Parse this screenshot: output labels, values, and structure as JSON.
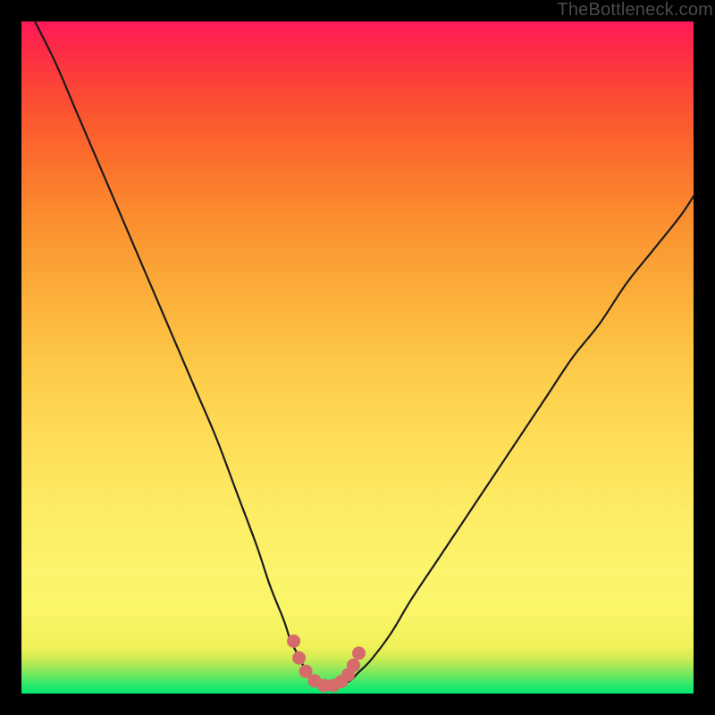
{
  "watermark": "TheBottleneck.com",
  "colors": {
    "bg": "#000000",
    "curve": "#1b1b1b",
    "marker_fill": "#d76b6b",
    "marker_stroke": "#c85a5a"
  },
  "chart_data": {
    "type": "line",
    "title": "",
    "xlabel": "",
    "ylabel": "",
    "xlim": [
      0,
      100
    ],
    "ylim": [
      0,
      100
    ],
    "grid": false,
    "annotations": [],
    "series": [
      {
        "name": "bottleneck-curve",
        "x": [
          2,
          5,
          8,
          11,
          14,
          17,
          20,
          23,
          26,
          29,
          32,
          35,
          37,
          39,
          40,
          41,
          42,
          43,
          44,
          45,
          46,
          47,
          48,
          49,
          50,
          52,
          55,
          58,
          62,
          66,
          70,
          74,
          78,
          82,
          86,
          90,
          94,
          98,
          100
        ],
        "y": [
          100,
          94,
          87,
          80,
          73,
          66,
          59,
          52,
          45,
          38,
          30,
          22,
          16,
          11,
          8,
          6,
          4,
          2.5,
          1.5,
          1,
          1,
          1,
          1.5,
          2,
          3,
          5,
          9,
          14,
          20,
          26,
          32,
          38,
          44,
          50,
          55,
          61,
          66,
          71,
          74
        ]
      }
    ],
    "markers": {
      "name": "optimal-zone-markers",
      "x": [
        40.5,
        41.3,
        42.3,
        43.6,
        45.0,
        46.4,
        47.6,
        48.6,
        49.4,
        50.2
      ],
      "y": [
        7.8,
        5.3,
        3.3,
        1.9,
        1.2,
        1.2,
        1.8,
        2.8,
        4.2,
        6.0
      ]
    }
  }
}
